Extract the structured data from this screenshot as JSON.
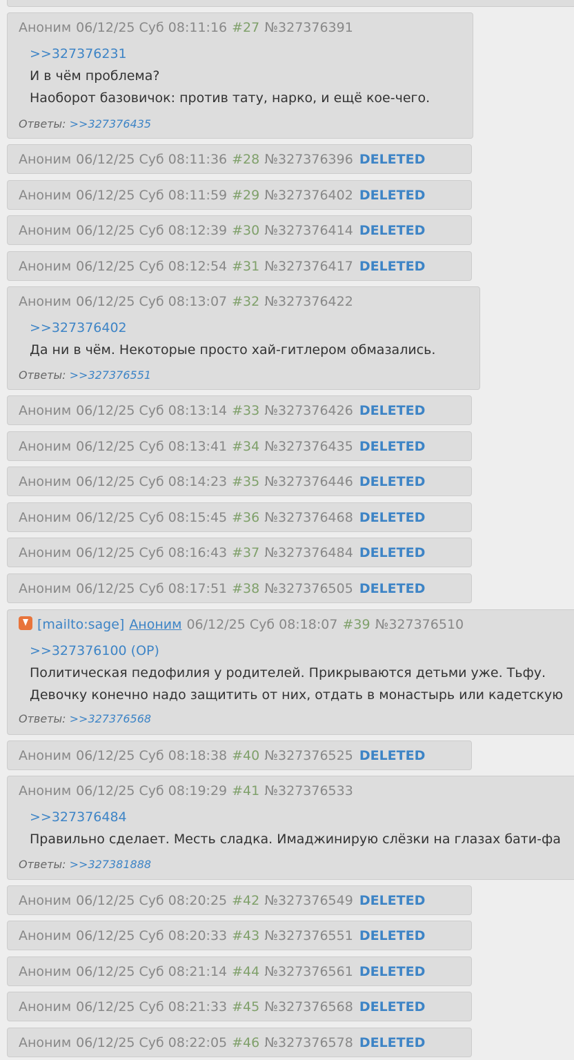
{
  "posts": [
    {
      "author": "Аноним",
      "date": "06/12/25 Суб 08:11:16",
      "num": "#27",
      "id": "№327376391",
      "reply_to": ">>327376231",
      "lines": [
        "И в чём проблема?",
        "Наоборот базовичок: против тату, нарко, и ещё кое-чего."
      ],
      "replies_label": "Ответы:",
      "replies": ">>327376435"
    },
    {
      "author": "Аноним",
      "date": "06/12/25 Суб 08:11:36",
      "num": "#28",
      "id": "№327376396",
      "status": "DELETED"
    },
    {
      "author": "Аноним",
      "date": "06/12/25 Суб 08:11:59",
      "num": "#29",
      "id": "№327376402",
      "status": "DELETED"
    },
    {
      "author": "Аноним",
      "date": "06/12/25 Суб 08:12:39",
      "num": "#30",
      "id": "№327376414",
      "status": "DELETED"
    },
    {
      "author": "Аноним",
      "date": "06/12/25 Суб 08:12:54",
      "num": "#31",
      "id": "№327376417",
      "status": "DELETED"
    },
    {
      "author": "Аноним",
      "date": "06/12/25 Суб 08:13:07",
      "num": "#32",
      "id": "№327376422",
      "reply_to": ">>327376402",
      "lines": [
        "Да ни в чём. Некоторые просто хай-гитлером обмазались."
      ],
      "replies_label": "Ответы:",
      "replies": ">>327376551"
    },
    {
      "author": "Аноним",
      "date": "06/12/25 Суб 08:13:14",
      "num": "#33",
      "id": "№327376426",
      "status": "DELETED"
    },
    {
      "author": "Аноним",
      "date": "06/12/25 Суб 08:13:41",
      "num": "#34",
      "id": "№327376435",
      "status": "DELETED"
    },
    {
      "author": "Аноним",
      "date": "06/12/25 Суб 08:14:23",
      "num": "#35",
      "id": "№327376446",
      "status": "DELETED"
    },
    {
      "author": "Аноним",
      "date": "06/12/25 Суб 08:15:45",
      "num": "#36",
      "id": "№327376468",
      "status": "DELETED"
    },
    {
      "author": "Аноним",
      "date": "06/12/25 Суб 08:16:43",
      "num": "#37",
      "id": "№327376484",
      "status": "DELETED"
    },
    {
      "author": "Аноним",
      "date": "06/12/25 Суб 08:17:51",
      "num": "#38",
      "id": "№327376505",
      "status": "DELETED"
    },
    {
      "mail": "[mailto:sage]",
      "author": "Аноним",
      "date": "06/12/25 Суб 08:18:07",
      "num": "#39",
      "id": "№327376510",
      "reply_to": ">>327376100 (OP)",
      "lines": [
        "Политическая педофилия у родителей. Прикрываются детьми уже. Тьфу.",
        "Девочку конечно надо защитить от них, отдать в монастырь или кадетскую"
      ],
      "replies_label": "Ответы:",
      "replies": ">>327376568"
    },
    {
      "author": "Аноним",
      "date": "06/12/25 Суб 08:18:38",
      "num": "#40",
      "id": "№327376525",
      "status": "DELETED"
    },
    {
      "author": "Аноним",
      "date": "06/12/25 Суб 08:19:29",
      "num": "#41",
      "id": "№327376533",
      "reply_to": ">>327376484",
      "lines": [
        "Правильно сделает. Месть сладка. Имаджинирую слёзки на глазах бати-фа"
      ],
      "replies_label": "Ответы:",
      "replies": ">>327381888"
    },
    {
      "author": "Аноним",
      "date": "06/12/25 Суб 08:20:25",
      "num": "#42",
      "id": "№327376549",
      "status": "DELETED"
    },
    {
      "author": "Аноним",
      "date": "06/12/25 Суб 08:20:33",
      "num": "#43",
      "id": "№327376551",
      "status": "DELETED"
    },
    {
      "author": "Аноним",
      "date": "06/12/25 Суб 08:21:14",
      "num": "#44",
      "id": "№327376561",
      "status": "DELETED"
    },
    {
      "author": "Аноним",
      "date": "06/12/25 Суб 08:21:33",
      "num": "#45",
      "id": "№327376568",
      "status": "DELETED"
    },
    {
      "author": "Аноним",
      "date": "06/12/25 Суб 08:22:05",
      "num": "#46",
      "id": "№327376578",
      "status": "DELETED"
    }
  ]
}
